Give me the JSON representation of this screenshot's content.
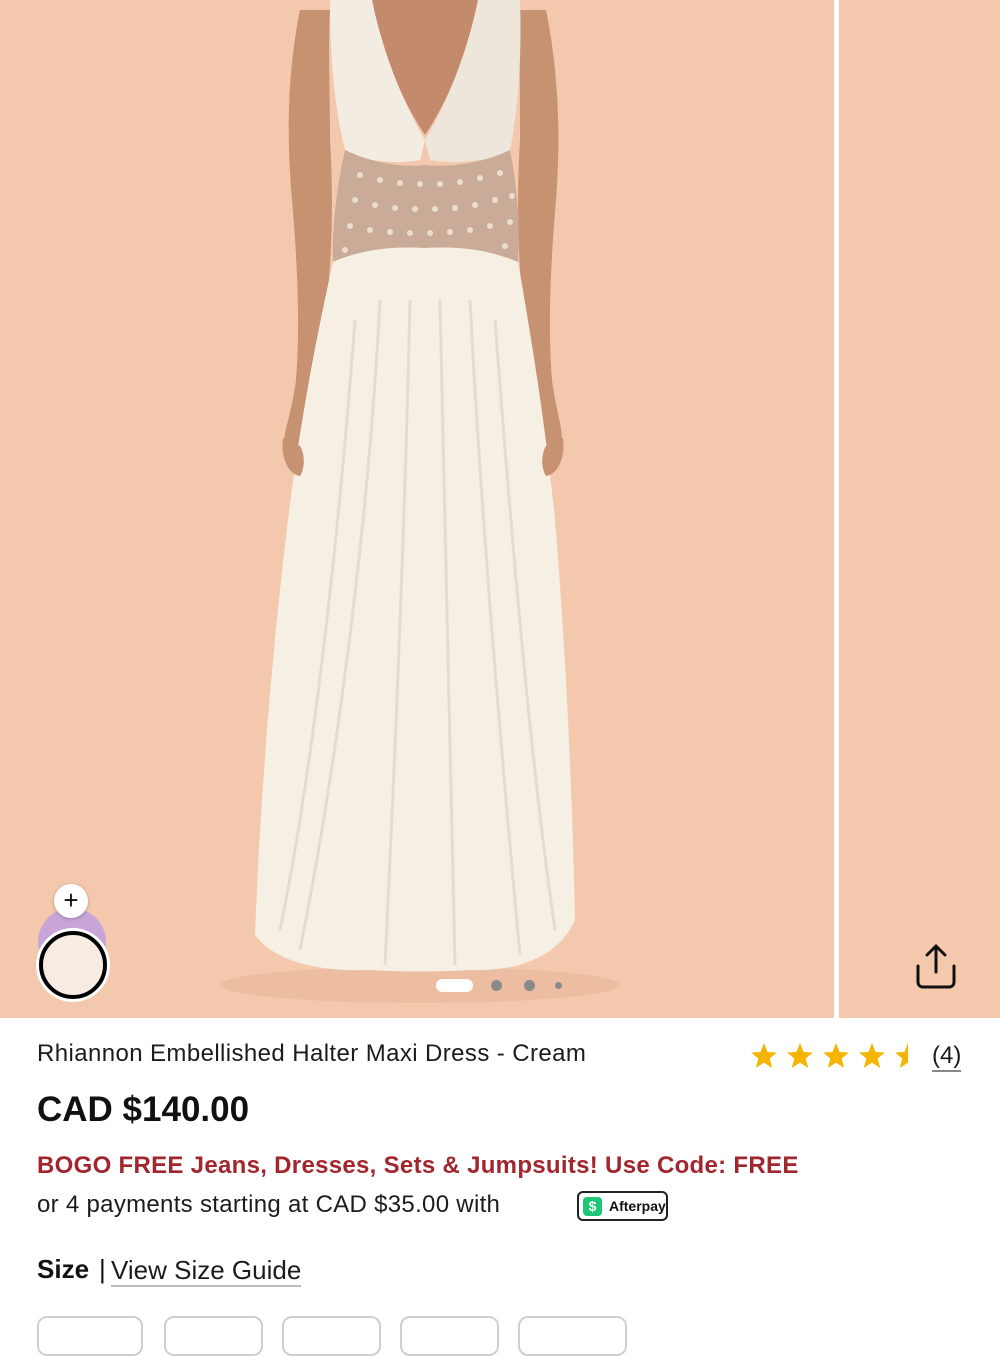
{
  "product": {
    "title": "Rhiannon Embellished Halter Maxi Dress - Cream",
    "price": "CAD $140.00",
    "rating": 4.5,
    "review_count": "(4)",
    "image_count": 4,
    "active_image_index": 0
  },
  "promo": {
    "text": "BOGO FREE Jeans, Dresses, Sets & Jumpsuits! Use Code: FREE"
  },
  "payment": {
    "installments_text": "or 4 payments starting at CAD $35.00 with",
    "provider": "Afterpay"
  },
  "size": {
    "label": "Size",
    "separator": "|",
    "guide_link": "View Size Guide"
  },
  "swatches": {
    "add_symbol": "+"
  },
  "icons": {
    "share": "share-icon",
    "add": "plus-icon",
    "star": "star-icon"
  },
  "colors": {
    "background": "#f3c8ad",
    "promo": "#a1262e",
    "star": "#f5b400",
    "afterpay": "#1ec677"
  }
}
